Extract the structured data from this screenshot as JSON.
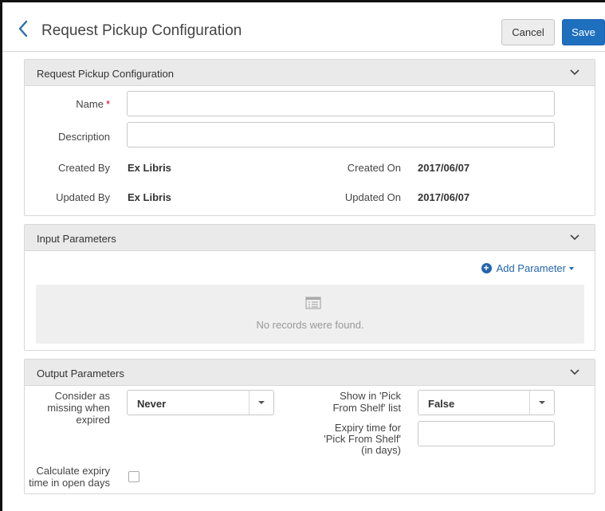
{
  "header": {
    "title": "Request Pickup Configuration",
    "cancel_label": "Cancel",
    "save_label": "Save"
  },
  "general": {
    "title": "Request Pickup Configuration",
    "name_label": "Name",
    "required_mark": "*",
    "name_value": "",
    "description_label": "Description",
    "description_value": "",
    "created_by_label": "Created By",
    "created_by_value": "Ex Libris",
    "created_on_label": "Created On",
    "created_on_value": "2017/06/07",
    "updated_by_label": "Updated By",
    "updated_by_value": "Ex Libris",
    "updated_on_label": "Updated On",
    "updated_on_value": "2017/06/07"
  },
  "input_params": {
    "title": "Input Parameters",
    "add_label": "Add Parameter",
    "empty_text": "No records were found."
  },
  "output_params": {
    "title": "Output Parameters",
    "missing_label_1": "Consider as",
    "missing_label_2": "missing when",
    "missing_label_3": "expired",
    "missing_value": "Never",
    "show_label_1": "Show in 'Pick",
    "show_label_2": "From Shelf' list",
    "show_value": "False",
    "expiry_label_1": "Expiry time for",
    "expiry_label_2": "'Pick From Shelf'",
    "expiry_label_3": "(in days)",
    "expiry_value": "",
    "calc_label_1": "Calculate expiry",
    "calc_label_2": "time in open days",
    "calc_checked": false
  },
  "colors": {
    "accent": "#1f6fbf",
    "required": "#d0021b",
    "section_header_bg": "#eaeaea"
  }
}
